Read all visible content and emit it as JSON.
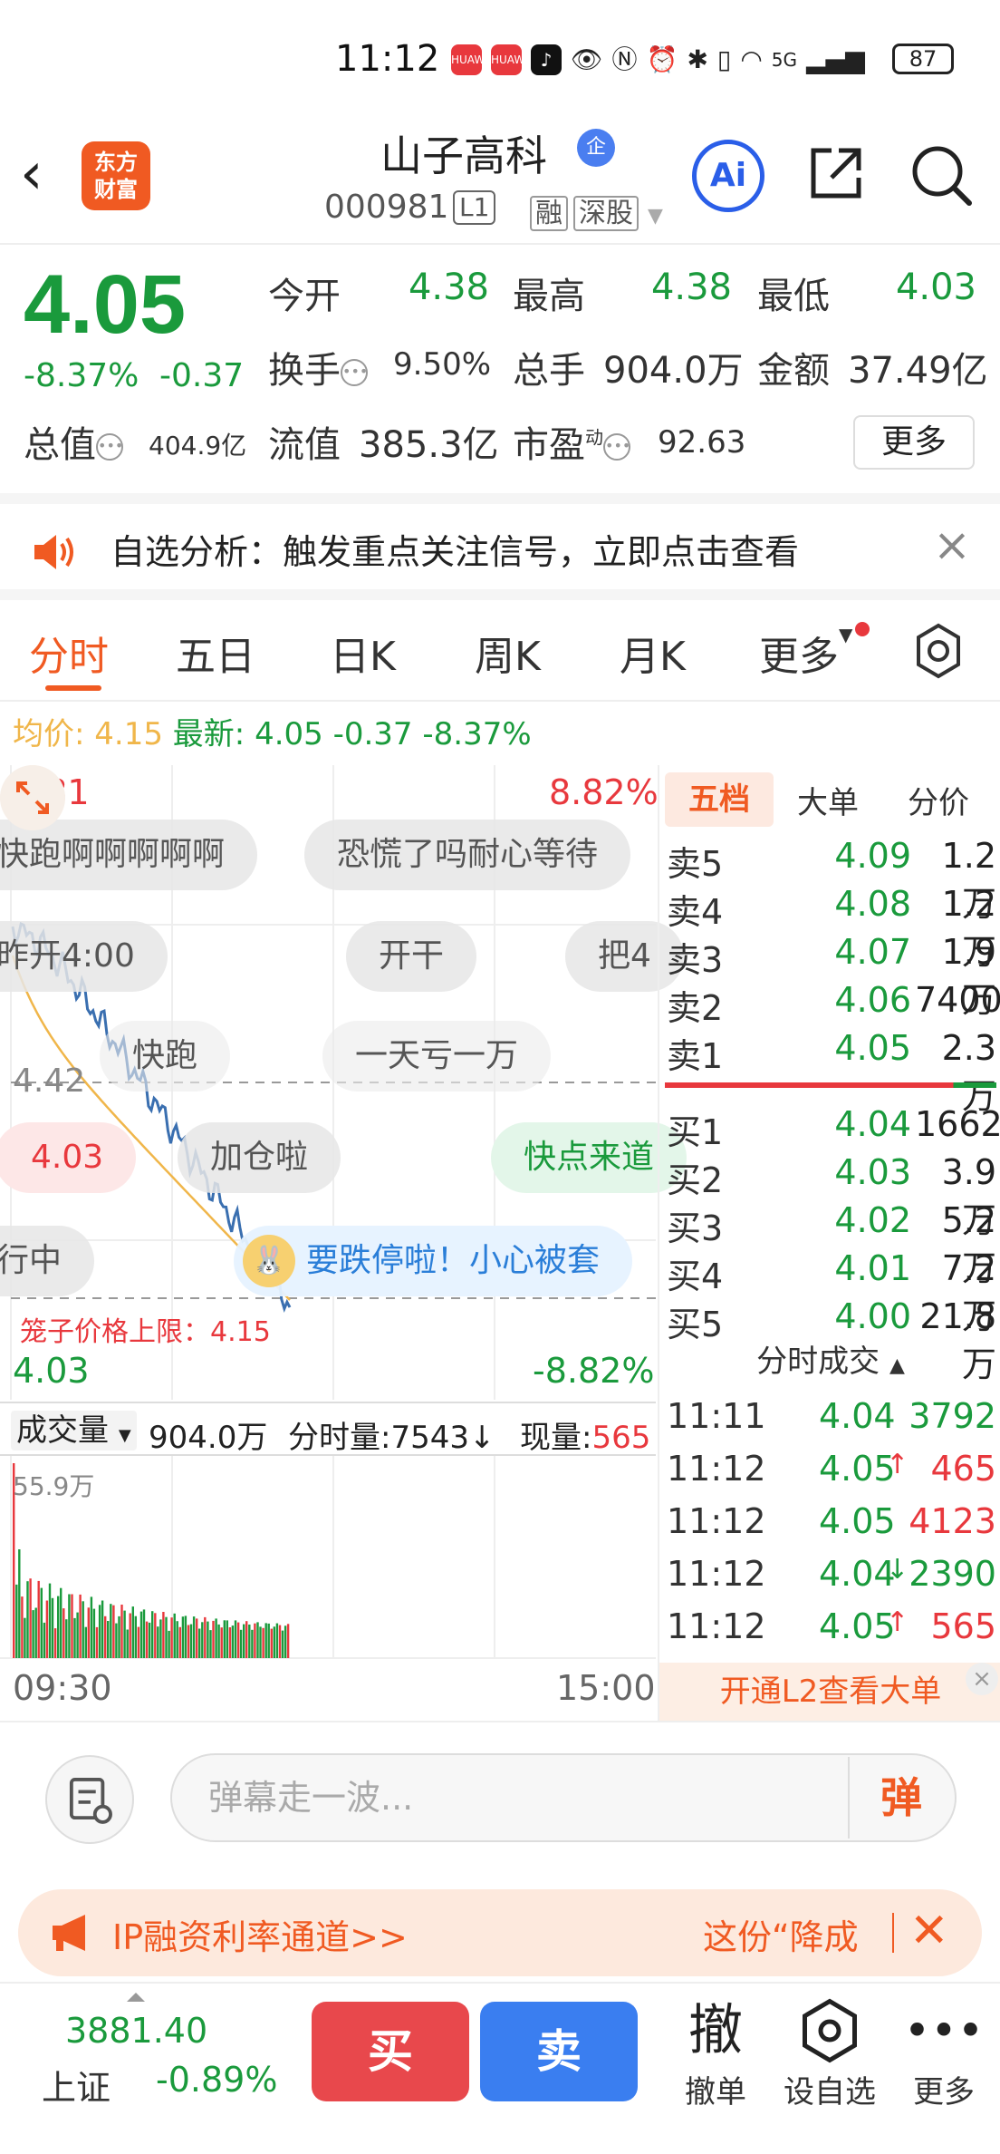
{
  "status_bar": {
    "time": "11:12",
    "battery": "87",
    "network": "5G",
    "app1": "HUAWEI",
    "app2": "HUAWEI"
  },
  "header": {
    "logo_line1": "东方",
    "logo_line2": "财富",
    "stock_name": "山子高科",
    "badge": "企",
    "stock_code": "000981",
    "level_badge": "L1",
    "tag_rong": "融",
    "tag_market": "深股",
    "ai_label": "Ai"
  },
  "quote": {
    "price": "4.05",
    "change_pct": "-8.37%",
    "change_abs": "-0.37",
    "open_label": "今开",
    "open": "4.38",
    "high_label": "最高",
    "high": "4.38",
    "low_label": "最低",
    "low": "4.03",
    "turnover_label": "换手",
    "turnover": "9.50%",
    "volume_label": "总手",
    "volume": "904.0万",
    "amount_label": "金额",
    "amount": "37.49亿",
    "mcap_label": "总值",
    "mcap": "404.9亿",
    "float_label": "流值",
    "float_cap": "385.3亿",
    "pe_label": "市盈",
    "pe_sup": "动",
    "pe": "92.63",
    "more_label": "更多"
  },
  "alert": {
    "text": "自选分析：触发重点关注信号，立即点击查看"
  },
  "tabs": [
    "分时",
    "五日",
    "日K",
    "周K",
    "月K",
    "更多"
  ],
  "avg_bar": {
    "avg_label": "均价:",
    "avg_value": "4.15",
    "latest_label": "最新:",
    "latest_value": "4.05",
    "change_abs": "-0.37",
    "change_pct": "-8.37%"
  },
  "chart": {
    "price_top": "4.81",
    "pct_top": "8.82%",
    "price_mid": "4.42",
    "price_bottom": "4.03",
    "pct_bottom": "-8.82%",
    "cage_label": "笼子价格上限：4.15",
    "time_start": "09:30",
    "time_end": "15:00",
    "volume_select": "成交量",
    "volume_total": "904.0万",
    "bucket_label": "分时量:7543↓",
    "current_label": "现量:",
    "current_value": "565",
    "volume_max": "55.9万",
    "danmu": [
      "快跑啊啊啊啊啊",
      "恐慌了吗耐心等待",
      "昨开4:00",
      "开干",
      "把4",
      "快跑",
      "一天亏一万",
      "4.03",
      "加仓啦",
      "快点来道",
      "行中",
      "要跌停啦！小心被套"
    ]
  },
  "order_book": {
    "tabs": [
      "五档",
      "大单",
      "分价"
    ],
    "asks": [
      {
        "label": "卖5",
        "price": "4.09",
        "vol": "1.2万"
      },
      {
        "label": "卖4",
        "price": "4.08",
        "vol": "1.2万"
      },
      {
        "label": "卖3",
        "price": "4.07",
        "vol": "1.9万"
      },
      {
        "label": "卖2",
        "price": "4.06",
        "vol": "7400"
      },
      {
        "label": "卖1",
        "price": "4.05",
        "vol": "2.3万"
      }
    ],
    "bids": [
      {
        "label": "买1",
        "price": "4.04",
        "vol": "1662"
      },
      {
        "label": "买2",
        "price": "4.03",
        "vol": "3.9万"
      },
      {
        "label": "买3",
        "price": "4.02",
        "vol": "5.2万"
      },
      {
        "label": "买4",
        "price": "4.01",
        "vol": "7.2万"
      },
      {
        "label": "买5",
        "price": "4.00",
        "vol": "21.8万"
      }
    ],
    "trades_title": "分时成交",
    "trades": [
      {
        "time": "11:11",
        "price": "4.04",
        "dir": "",
        "vol": "3792",
        "color": "#1a9a3c"
      },
      {
        "time": "11:12",
        "price": "4.05",
        "dir": "↑",
        "vol": "465",
        "color": "#e8383d"
      },
      {
        "time": "11:12",
        "price": "4.05",
        "dir": "",
        "vol": "4123",
        "color": "#e8383d"
      },
      {
        "time": "11:12",
        "price": "4.04",
        "dir": "↓",
        "vol": "2390",
        "color": "#1a9a3c"
      },
      {
        "time": "11:12",
        "price": "4.05",
        "dir": "↑",
        "vol": "565",
        "color": "#e8383d"
      }
    ],
    "l2_banner": "开通L2查看大单"
  },
  "danmu_input": {
    "placeholder": "弹幕走一波...",
    "send": "弹"
  },
  "promo": {
    "text": "IP融资利率通道>>",
    "right_text": "这份“降成"
  },
  "bottom": {
    "index_value": "3881.40",
    "index_name": "上证",
    "index_change": "-0.89%",
    "buy": "买",
    "sell": "卖",
    "cancel_icon": "撤",
    "cancel_label": "撤单",
    "watch_label": "设自选",
    "more_label": "更多"
  },
  "colors": {
    "up": "#e8383d",
    "down": "#1a9a3c",
    "brand": "#f05a22",
    "avg_line": "#f0b64a",
    "price_line": "#3a6fb0"
  }
}
